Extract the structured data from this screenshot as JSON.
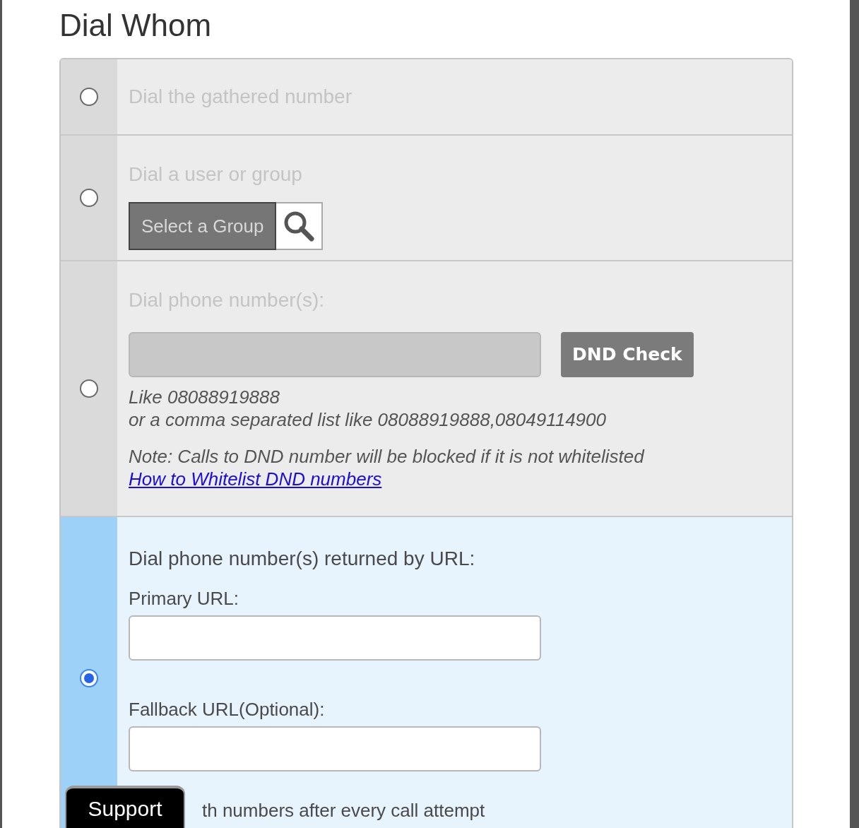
{
  "heading": "Dial Whom",
  "options": [
    {
      "kind": "simple",
      "label": "Dial the gathered number",
      "selected": false
    },
    {
      "kind": "group",
      "label": "Dial a user or group",
      "selected": false,
      "button": "Select a Group"
    },
    {
      "kind": "phone",
      "label": "Dial phone number(s):",
      "selected": false,
      "check_button": "DND Check",
      "hint_lines": [
        "Like 08088919888",
        "or a comma separated list like 08088919888,08049114900"
      ],
      "note": "Note: Calls to DND number will be blocked if it is not whitelisted",
      "link": "How to Whitelist DND numbers"
    },
    {
      "kind": "url",
      "label": "Dial phone number(s) returned by URL:",
      "selected": true,
      "primary_label": "Primary URL:",
      "fallback_label": "Fallback URL(Optional):",
      "footer": "th numbers after every call attempt"
    }
  ],
  "support_button": "Support"
}
